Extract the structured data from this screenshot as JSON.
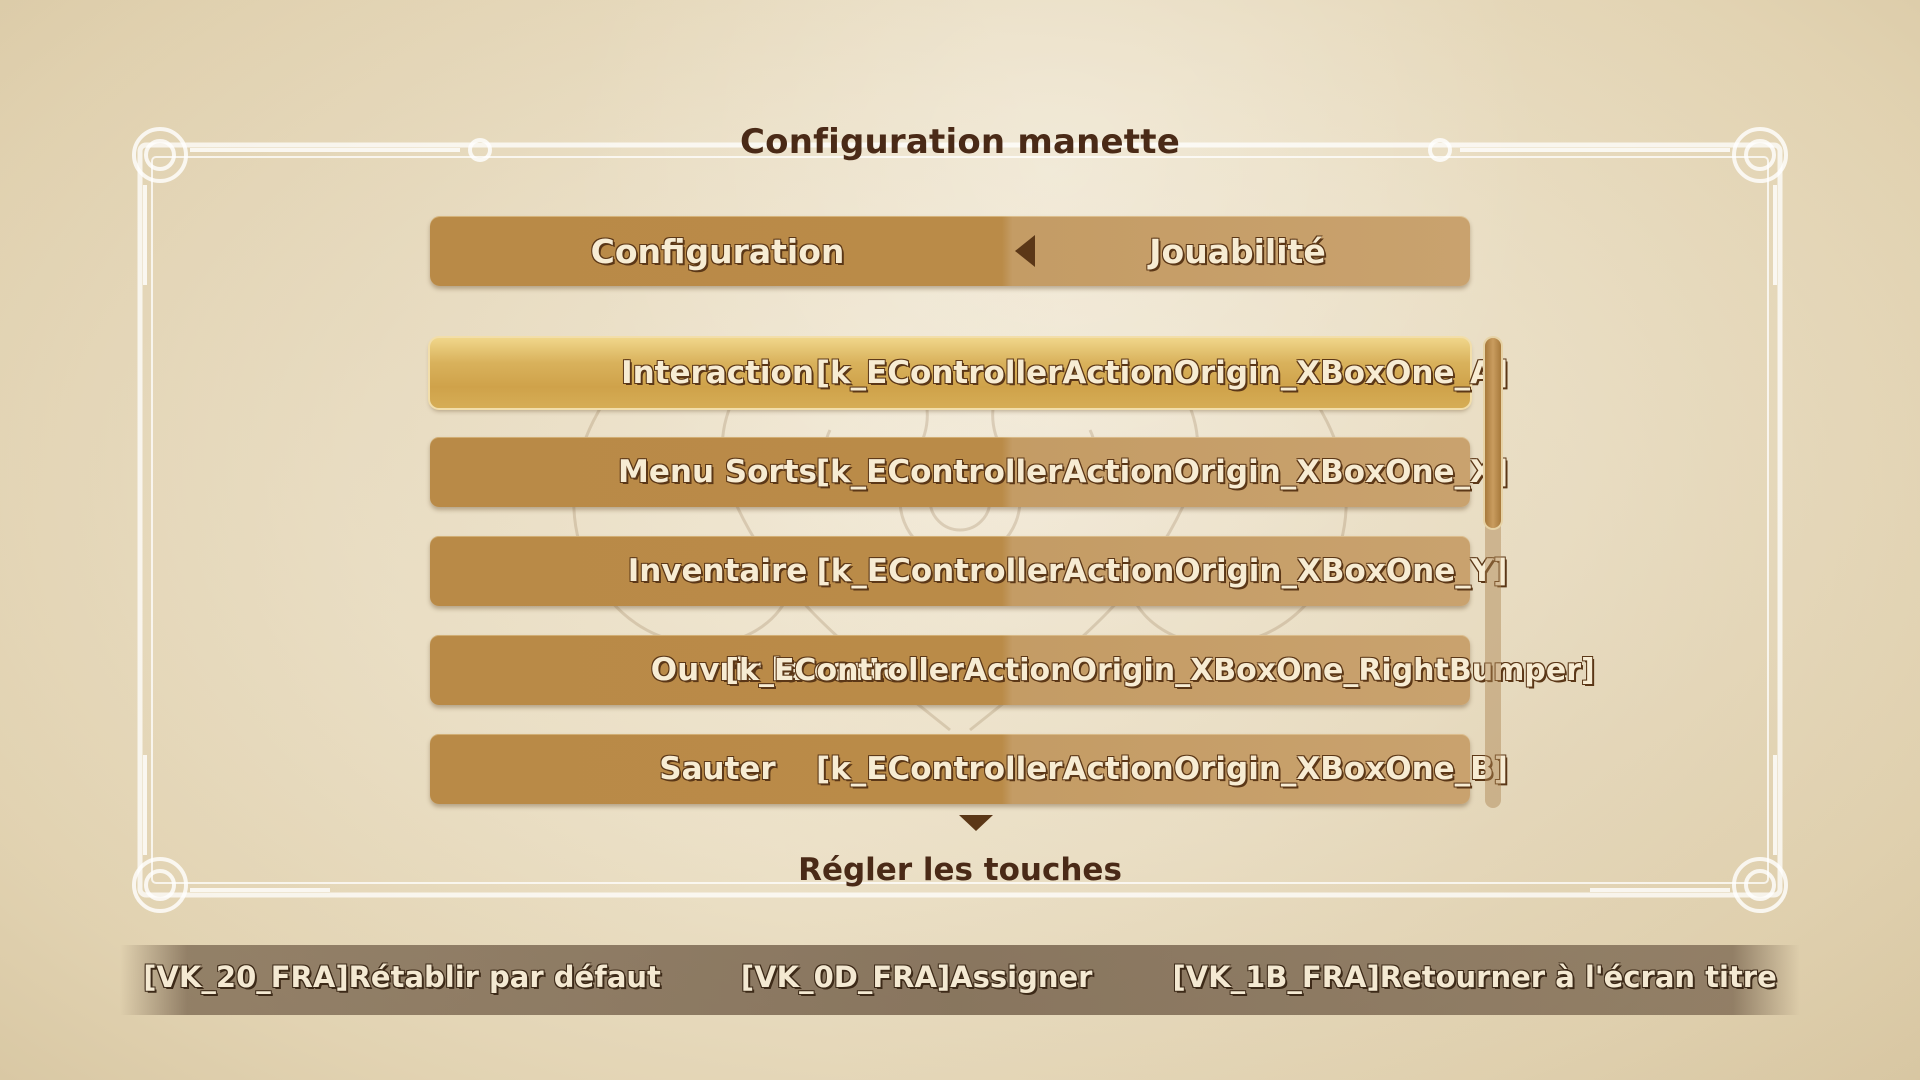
{
  "header": {
    "title": "Configuration manette"
  },
  "tabs": {
    "left_label": "Configuration",
    "right_label": "Jouabilité"
  },
  "bindings": [
    {
      "action": "Interaction",
      "binding": "[k_EControllerActionOrigin_XBoxOne_A]",
      "selected": true
    },
    {
      "action": "Menu Sorts",
      "binding": "[k_EControllerActionOrigin_XBoxOne_X]",
      "selected": false
    },
    {
      "action": "Inventaire",
      "binding": "[k_EControllerActionOrigin_XBoxOne_Y]",
      "selected": false
    },
    {
      "action": "Ouvrir la carte",
      "binding": "[k_EControllerActionOrigin_XBoxOne_RightBumper]",
      "selected": false
    },
    {
      "action": "Sauter",
      "binding": "[k_EControllerActionOrigin_XBoxOne_B]",
      "selected": false
    }
  ],
  "section": {
    "subtitle": "Régler les touches"
  },
  "footer": {
    "reset_label": "[VK_20_FRA]Rétablir par défaut",
    "assign_label": "[VK_0D_FRA]Assigner",
    "back_label": "[VK_1B_FRA]Retourner à l'écran titre"
  },
  "colors": {
    "accent": "#b98a47",
    "text_dark": "#4a2a17",
    "outline": "#5b3717",
    "selected_row": "#d9b25c"
  },
  "icons": {
    "prev_tab": "triangle-left-icon",
    "next_tab": "triangle-right-icon",
    "scroll_more": "triangle-down-icon"
  }
}
